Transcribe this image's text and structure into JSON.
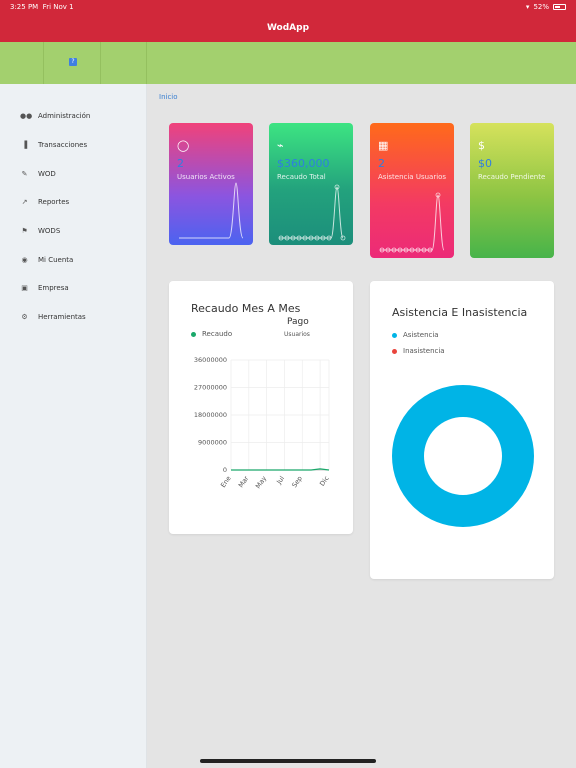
{
  "status": {
    "time": "3:25 PM",
    "date": "Fri Nov 1",
    "battery": "52%"
  },
  "app_title": "WodApp",
  "help_icon_glyph": "?",
  "breadcrumb": "Inicio",
  "sidebar": {
    "items": [
      {
        "label": "Administración",
        "icon": "users-icon"
      },
      {
        "label": "Transacciones",
        "icon": "bar-chart-icon"
      },
      {
        "label": "WOD",
        "icon": "edit-icon"
      },
      {
        "label": "Reportes",
        "icon": "line-chart-icon"
      },
      {
        "label": "WODS",
        "icon": "flag-icon"
      },
      {
        "label": "Mi Cuenta",
        "icon": "account-icon"
      },
      {
        "label": "Empresa",
        "icon": "briefcase-icon"
      },
      {
        "label": "Herramientas",
        "icon": "cogs-icon"
      }
    ]
  },
  "cards": [
    {
      "value": "2",
      "label": "Usuarios Activos",
      "icon": "user-icon"
    },
    {
      "value": "$360,000",
      "label": "Recaudo Total",
      "icon": "cart-icon"
    },
    {
      "value": "2",
      "label": "Asistencia Usuarios",
      "icon": "calendar-icon"
    },
    {
      "value": "$0",
      "label": "Recaudo Pendiente",
      "icon": "dollar-icon"
    }
  ],
  "colors": {
    "header": "#d1283a",
    "subheader": "#a3d06e",
    "recaudo_series": "#1aa86a",
    "asistencia": "#00b4e6",
    "inasistencia": "#e9443c"
  },
  "line_panel": {
    "title": "Recaudo Mes A Mes",
    "legend_recaudo": "Recaudo",
    "legend_pago": "Pago",
    "legend_usuarios": "Usuarios"
  },
  "donut_panel": {
    "title": "Asistencia E Inasistencia",
    "legend": [
      "Asistencia",
      "Inasistencia"
    ]
  },
  "chart_data": [
    {
      "type": "line",
      "title": "Recaudo Mes A Mes",
      "legend": [
        "Recaudo"
      ],
      "x": [
        "Ene",
        "Feb",
        "Mar",
        "Abr",
        "May",
        "Jun",
        "Jul",
        "Ago",
        "Sep",
        "Oct",
        "Nov",
        "Dic"
      ],
      "x_tick_labels": [
        "Ene",
        "Mar",
        "May",
        "Jul",
        "Sep",
        "Dic"
      ],
      "y_ticks": [
        "36000000",
        "27000000",
        "18000000",
        "9000000",
        "0"
      ],
      "ylim": [
        0,
        36000000
      ],
      "grid": true,
      "series": [
        {
          "name": "Recaudo",
          "values": [
            0,
            0,
            0,
            0,
            0,
            0,
            0,
            0,
            0,
            0,
            360000,
            0
          ]
        }
      ]
    },
    {
      "type": "pie",
      "title": "Asistencia E Inasistencia",
      "legend": [
        "Asistencia",
        "Inasistencia"
      ],
      "values": [
        2,
        0
      ]
    }
  ]
}
